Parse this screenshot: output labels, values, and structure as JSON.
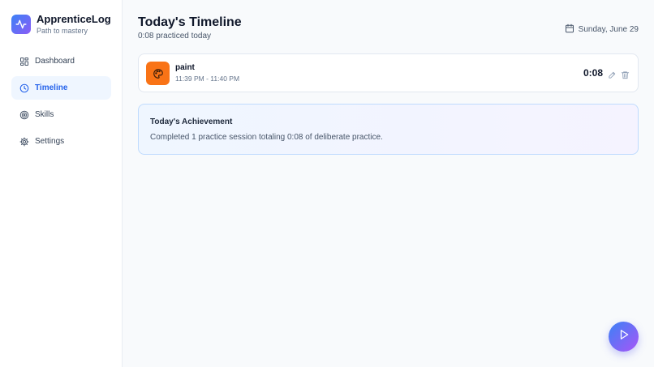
{
  "brand": {
    "name": "ApprenticeLog",
    "tagline": "Path to mastery",
    "icon": "activity-icon"
  },
  "nav": [
    {
      "label": "Dashboard",
      "icon": "grid-icon",
      "active": false
    },
    {
      "label": "Timeline",
      "icon": "clock-icon",
      "active": true
    },
    {
      "label": "Skills",
      "icon": "target-icon",
      "active": false
    },
    {
      "label": "Settings",
      "icon": "gear-icon",
      "active": false
    }
  ],
  "header": {
    "title": "Today's Timeline",
    "subtitle": "0:08 practiced today",
    "date": "Sunday, June 29"
  },
  "sessions": [
    {
      "skill": "paint",
      "time_range": "11:39 PM - 11:40 PM",
      "duration": "0:08",
      "icon": "palette-icon",
      "color": "#f97316"
    }
  ],
  "achievement": {
    "title": "Today's Achievement",
    "text": "Completed 1 practice session totaling 0:08 of deliberate practice."
  },
  "colors": {
    "accent": "#2563eb",
    "brand_gradient_start": "#3b82f6",
    "brand_gradient_end": "#8b5cf6"
  }
}
